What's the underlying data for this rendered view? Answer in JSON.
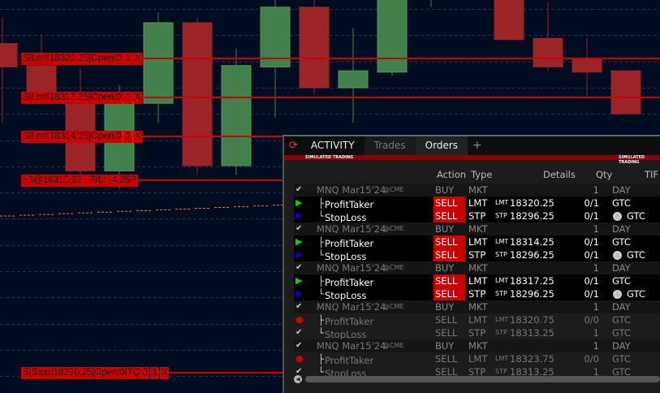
{
  "chart": {
    "candles": [
      {
        "o": 18321.4,
        "c": 18319.6,
        "h": 18323.4,
        "l": 18315.3
      },
      {
        "o": 18319.7,
        "c": 18317.2,
        "h": 18322.1,
        "l": 18316.8
      },
      {
        "o": 18316.9,
        "c": 18311.6,
        "h": 18319.5,
        "l": 18310.5
      },
      {
        "o": 18311.6,
        "c": 18316.9,
        "h": 18318.2,
        "l": 18310.2
      },
      {
        "o": 18316.8,
        "c": 18323.0,
        "h": 18323.8,
        "l": 18315.3
      },
      {
        "o": 18323.0,
        "c": 18312.0,
        "h": 18323.4,
        "l": 18311.3
      },
      {
        "o": 18312.0,
        "c": 18319.7,
        "h": 18321.0,
        "l": 18311.3
      },
      {
        "o": 18319.6,
        "c": 18324.2,
        "h": 18325.7,
        "l": 18315.7
      },
      {
        "o": 18324.2,
        "c": 18318.0,
        "h": 18325.0,
        "l": 18317.5
      },
      {
        "o": 18318.0,
        "c": 18319.3,
        "h": 18322.6,
        "l": 18315.3
      },
      {
        "o": 18319.2,
        "c": 18325.7,
        "h": 18325.7,
        "l": 18318.9
      },
      {
        "o": 18325.7,
        "c": 18325.7,
        "h": 18325.7,
        "l": 18324.2
      },
      {
        "o": 18325.7,
        "c": 18325.7,
        "h": 18325.7,
        "l": 18325.4
      },
      {
        "o": 18325.7,
        "c": 18321.7,
        "h": 18325.7,
        "l": 18321.7
      },
      {
        "o": 18321.8,
        "c": 18319.6,
        "h": 18324.6,
        "l": 18319.3
      },
      {
        "o": 18320.2,
        "c": 18319.2,
        "h": 18321.8,
        "l": 18317.3
      },
      {
        "o": 18319.3,
        "c": 18316.0,
        "h": 18319.3,
        "l": 18316.0
      }
    ],
    "orders": [
      {
        "parts": [
          "S|Lmt|18320.25|Open|0",
          "1",
          "X"
        ]
      },
      {
        "parts": [
          "S|Lmt|18317.25|Open|0",
          "1",
          "X"
        ]
      },
      {
        "parts": [
          "S|Lmt|18314.25|Open|0",
          "1",
          "X"
        ]
      },
      {
        "parts": [
          "+3@18310.92 | P/L: -4.25P"
        ]
      },
      {
        "parts": [
          "S|Stop|18296.25|Open|0|TQ:3",
          "1",
          "X"
        ]
      }
    ],
    "colors": {
      "up": "#41804a",
      "down": "#9b2426",
      "order": "#cc0000",
      "vwap": "#e07a10"
    }
  },
  "panel": {
    "tabs": [
      "ACTIVITY",
      "Trades",
      "Orders",
      "+"
    ],
    "banner": "SIMULATED TRADING",
    "headers": {
      "action": "Action",
      "type": "Type",
      "details": "Details",
      "qty": "Qty",
      "tif": "TIF"
    },
    "rows": [
      {
        "kind": "p",
        "name": "MNQ Mar15'24",
        "exch": "@CME",
        "action": "BUY",
        "type": "MKT",
        "dpre": "",
        "details": "",
        "qty": "1",
        "tif": "DAY",
        "icon": "check"
      },
      {
        "kind": "c",
        "name": "ProfitTaker",
        "action": "SELL",
        "type": "LMT",
        "dpre": "LMT",
        "details": "18320.25",
        "qty": "0/1",
        "tif": "GTC",
        "icon": "green"
      },
      {
        "kind": "c",
        "name": "StopLoss",
        "action": "SELL",
        "type": "STP",
        "dpre": "STP",
        "details": "18296.25",
        "qty": "0/1",
        "tif": "GTC",
        "icon": "blue",
        "warn": true
      },
      {
        "kind": "p",
        "name": "MNQ Mar15'24",
        "exch": "@CME",
        "action": "BUY",
        "type": "MKT",
        "dpre": "",
        "details": "",
        "qty": "1",
        "tif": "DAY",
        "icon": "check"
      },
      {
        "kind": "c",
        "name": "ProfitTaker",
        "action": "SELL",
        "type": "LMT",
        "dpre": "LMT",
        "details": "18314.25",
        "qty": "0/1",
        "tif": "GTC",
        "icon": "green"
      },
      {
        "kind": "c",
        "name": "StopLoss",
        "action": "SELL",
        "type": "STP",
        "dpre": "STP",
        "details": "18296.25",
        "qty": "0/1",
        "tif": "GTC",
        "icon": "blue",
        "warn": true
      },
      {
        "kind": "p",
        "name": "MNQ Mar15'24",
        "exch": "@CME",
        "action": "BUY",
        "type": "MKT",
        "dpre": "",
        "details": "",
        "qty": "1",
        "tif": "DAY",
        "icon": "check"
      },
      {
        "kind": "c",
        "name": "ProfitTaker",
        "action": "SELL",
        "type": "LMT",
        "dpre": "LMT",
        "details": "18317.25",
        "qty": "0/1",
        "tif": "GTC",
        "icon": "green"
      },
      {
        "kind": "c",
        "name": "StopLoss",
        "action": "SELL",
        "type": "STP",
        "dpre": "STP",
        "details": "18296.25",
        "qty": "0/1",
        "tif": "GTC",
        "icon": "blue",
        "warn": true
      },
      {
        "kind": "p",
        "name": "MNQ Mar15'24",
        "exch": "@CME",
        "action": "BUY",
        "type": "MKT",
        "dpre": "",
        "details": "",
        "qty": "1",
        "tif": "DAY",
        "icon": "check"
      },
      {
        "kind": "d",
        "name": "ProfitTaker",
        "action": "SELL",
        "type": "LMT",
        "dpre": "LMT",
        "details": "18320.75",
        "qty": "0/0",
        "tif": "GTC",
        "icon": "error"
      },
      {
        "kind": "d",
        "name": "StopLoss",
        "action": "SELL",
        "type": "STP",
        "dpre": "STP",
        "details": "18313.25",
        "qty": "1",
        "tif": "GTC",
        "icon": "check"
      },
      {
        "kind": "p",
        "name": "MNQ Mar15'24",
        "exch": "@CME",
        "action": "BUY",
        "type": "MKT",
        "dpre": "",
        "details": "",
        "qty": "1",
        "tif": "DAY",
        "icon": "check"
      },
      {
        "kind": "d",
        "name": "ProfitTaker",
        "action": "SELL",
        "type": "LMT",
        "dpre": "LMT",
        "details": "18323.75",
        "qty": "0/0",
        "tif": "GTC",
        "icon": "error"
      },
      {
        "kind": "d",
        "name": "StopLoss",
        "action": "SELL",
        "type": "STP",
        "dpre": "STP",
        "details": "18313.25",
        "qty": "1",
        "tif": "GTC",
        "icon": "check"
      }
    ]
  }
}
